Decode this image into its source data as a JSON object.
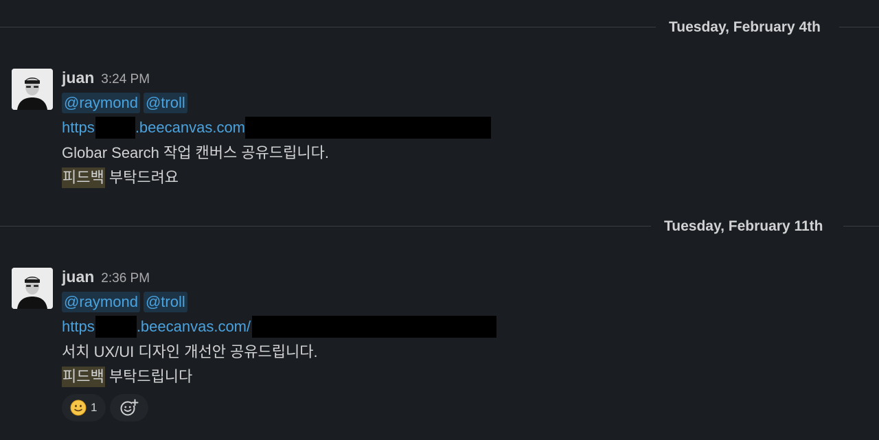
{
  "channel": {
    "day_dividers": [
      {
        "label": "Tuesday, February 4th"
      },
      {
        "label": "Tuesday, February 11th"
      }
    ],
    "messages": [
      {
        "author": "juan",
        "time": "3:24 PM",
        "avatar_icon": "user-avatar-photo",
        "mentions": [
          "@raymond",
          "@troll"
        ],
        "link": {
          "prefix": "https:",
          "domain": ".beecanvas.com/"
        },
        "text": "Globar Search 작업 캔버스 공유드립니다.",
        "feedback": {
          "highlight": "피드백",
          "rest": " 부탁드려요"
        }
      },
      {
        "author": "juan",
        "time": "2:36 PM",
        "avatar_icon": "user-avatar-photo",
        "mentions": [
          "@raymond",
          "@troll"
        ],
        "link": {
          "prefix": "https:",
          "domain": ".beecanvas.com/"
        },
        "text": "서치 UX/UI 디자인 개선안 공유드립니다.",
        "feedback": {
          "highlight": "피드백",
          "rest": " 부탁드립니다"
        },
        "reactions": [
          {
            "emoji": "slightly-smiling-face-icon",
            "count": "1"
          }
        ],
        "add_reaction_icon": "add-reaction-icon"
      }
    ]
  },
  "colors": {
    "background": "#1a1d21",
    "text": "#d1d2d3",
    "link": "#4aa3df",
    "mention_bg": "#1d3447",
    "highlight_bg": "#443f2b",
    "divider": "#3a3d41"
  }
}
